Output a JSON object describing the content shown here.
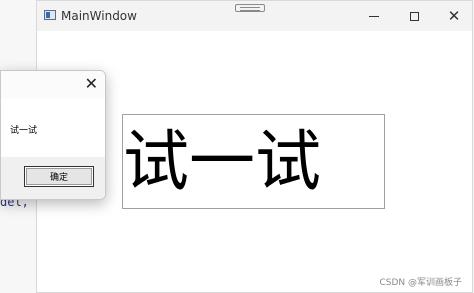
{
  "background_editor": {
    "code_fragment": "del,"
  },
  "main_window": {
    "title": "MainWindow",
    "controls": {
      "minimize_icon": "minimize-icon",
      "maximize_icon": "maximize-icon",
      "close_icon": "close-icon"
    },
    "label_text": "试一试",
    "watermark": "CSDN @军训画板子"
  },
  "dialog": {
    "message": "试一试",
    "ok_label": "确定",
    "close_glyph": "✕"
  }
}
